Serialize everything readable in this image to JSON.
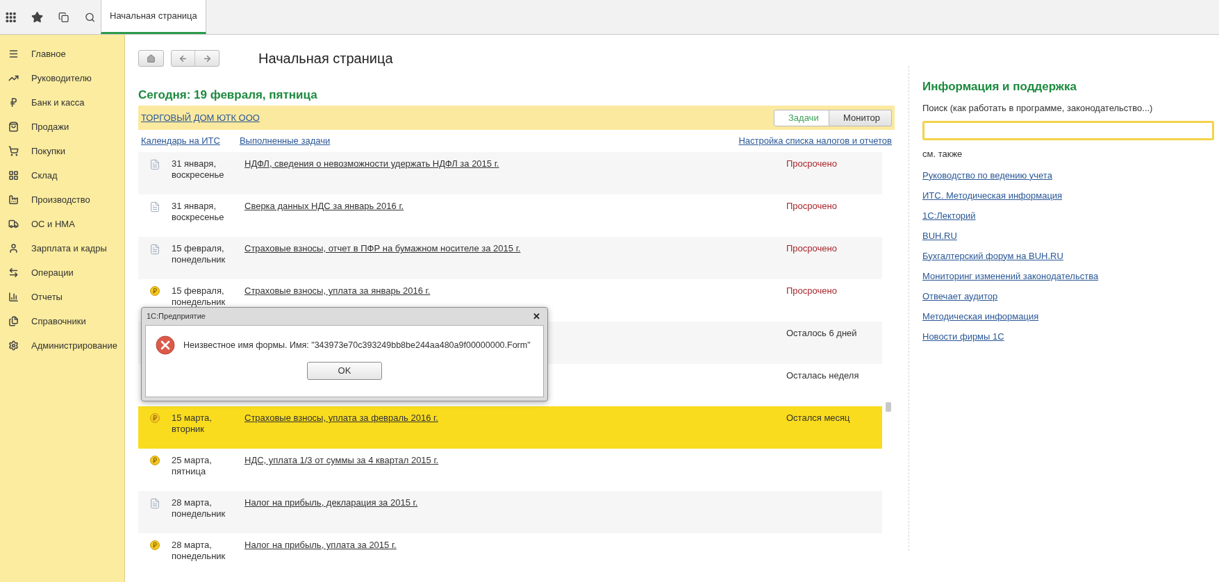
{
  "top_bar": {
    "tabs": [
      {
        "label": "Начальная страница",
        "selected": true
      }
    ]
  },
  "sidebar": {
    "items": [
      {
        "label": "Главное"
      },
      {
        "label": "Руководителю"
      },
      {
        "label": "Банк и касса"
      },
      {
        "label": "Продажи"
      },
      {
        "label": "Покупки"
      },
      {
        "label": "Склад"
      },
      {
        "label": "Производство"
      },
      {
        "label": "ОС и НМА"
      },
      {
        "label": "Зарплата и кадры"
      },
      {
        "label": "Операции"
      },
      {
        "label": "Отчеты"
      },
      {
        "label": "Справочники"
      },
      {
        "label": "Администрирование"
      }
    ]
  },
  "page": {
    "title": "Начальная страница",
    "today": "Сегодня: 19 февраля, пятница",
    "company": "ТОРГОВЫЙ ДОМ ЮТК ООО",
    "view_switch": [
      {
        "label": "Задачи",
        "selected": true
      },
      {
        "label": "Монитор",
        "selected": false
      }
    ],
    "links": [
      "Календарь на ИТС",
      "Выполненные задачи"
    ],
    "settings_link": "Настройка списка налогов и отчетов",
    "tasks": [
      {
        "kind": "document",
        "date": "31 января,",
        "weekday": "воскресенье",
        "title": "НДФЛ, сведения о невозможности удержать НДФЛ за 2015 г.",
        "status": "Просрочено",
        "overdue": true,
        "selected": false
      },
      {
        "kind": "document",
        "date": "31 января,",
        "weekday": "воскресенье",
        "title": "Сверка данных НДС за январь 2016 г.",
        "status": "Просрочено",
        "overdue": true,
        "selected": false
      },
      {
        "kind": "document",
        "date": "15 февраля,",
        "weekday": "понедельник",
        "title": "Страховые взносы, отчет в ПФР на бумажном носителе за 2015 г.",
        "status": "Просрочено",
        "overdue": true,
        "selected": false
      },
      {
        "kind": "payment",
        "date": "15 февраля,",
        "weekday": "понедельник",
        "title": "Страховые взносы, уплата за январь 2016 г.",
        "status": "Просрочено",
        "overdue": true,
        "selected": false
      },
      {
        "kind": "hidden",
        "status": "Осталось 6 дней",
        "overdue": false,
        "selected": false
      },
      {
        "kind": "hidden",
        "status": "Осталась неделя",
        "overdue": false,
        "selected": false
      },
      {
        "kind": "payment",
        "date": "15 марта,",
        "weekday": "вторник",
        "title": "Страховые взносы, уплата за февраль 2016 г.",
        "status": "Остался месяц",
        "overdue": false,
        "selected": true
      },
      {
        "kind": "payment",
        "date": "25 марта,",
        "weekday": "пятница",
        "title": "НДС, уплата 1/3 от суммы за 4 квартал 2015 г.",
        "selected": false
      },
      {
        "kind": "document",
        "date": "28 марта,",
        "weekday": "понедельник",
        "title": "Налог на прибыль, декларация за 2015 г.",
        "selected": false
      },
      {
        "kind": "payment",
        "date": "28 марта,",
        "weekday": "понедельник",
        "title": "Налог на прибыль, уплата за 2015 г.",
        "selected": false
      }
    ]
  },
  "support": {
    "title": "Информация и поддержка",
    "search_label": "Поиск (как работать в программе, законодательство...)",
    "see_also": "см. также",
    "links": [
      "Руководство по ведению учета",
      "ИТС. Методическая информация",
      "1С:Лекторий",
      "BUH.RU",
      "Бухгалтерский форум на BUH.RU",
      "Мониторинг изменений законодательства",
      "Отвечает аудитор",
      "Методическая информация",
      "Новости фирмы 1С"
    ]
  },
  "dialog": {
    "title": "1С:Предприятие",
    "close": "✕",
    "message": "Неизвестное имя формы. Имя: \"343973e70c393249bb8be244aa480a9f00000000.Form\"",
    "button": "OK"
  }
}
